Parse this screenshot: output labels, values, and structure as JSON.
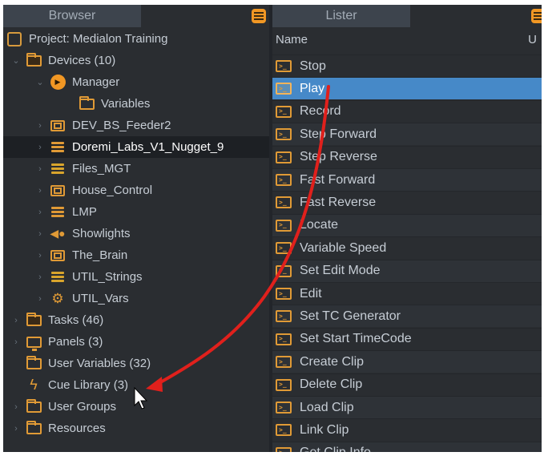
{
  "browser": {
    "title": "Browser",
    "tree": [
      {
        "label": "Project: Medialon Training",
        "icon": "project-icon",
        "chevron": ""
      },
      {
        "label": "Devices (10)",
        "icon": "folder-icon",
        "chevron": "down"
      },
      {
        "label": "Manager",
        "icon": "manager-play-icon",
        "chevron": "down"
      },
      {
        "label": "Variables",
        "icon": "variables-folder-icon",
        "chevron": ""
      },
      {
        "label": "DEV_BS_Feeder2",
        "icon": "device-icon",
        "chevron": "right"
      },
      {
        "label": "Doremi_Labs_V1_Nugget_9",
        "icon": "server-stack-icon",
        "chevron": "right"
      },
      {
        "label": "Files_MGT",
        "icon": "files-stack-icon",
        "chevron": "right"
      },
      {
        "label": "House_Control",
        "icon": "device-icon",
        "chevron": "right"
      },
      {
        "label": "LMP",
        "icon": "server-stack-icon",
        "chevron": "right"
      },
      {
        "label": "Showlights",
        "icon": "spotlight-icon",
        "chevron": "right"
      },
      {
        "label": "The_Brain",
        "icon": "device-icon",
        "chevron": "right"
      },
      {
        "label": "UTIL_Strings",
        "icon": "strings-stack-icon",
        "chevron": "right"
      },
      {
        "label": "UTIL_Vars",
        "icon": "gear-icon",
        "chevron": "right"
      },
      {
        "label": "Tasks (46)",
        "icon": "tasks-folder-icon",
        "chevron": "right"
      },
      {
        "label": "Panels (3)",
        "icon": "monitor-icon",
        "chevron": "right"
      },
      {
        "label": "User Variables (32)",
        "icon": "user-variables-icon",
        "chevron": ""
      },
      {
        "label": "Cue Library (3)",
        "icon": "lightning-icon",
        "chevron": ""
      },
      {
        "label": "User Groups",
        "icon": "folder-icon",
        "chevron": "right"
      },
      {
        "label": "Resources",
        "icon": "folder-icon",
        "chevron": "right"
      }
    ],
    "selected_item": "Doremi_Labs_V1_Nugget_9"
  },
  "lister": {
    "title": "Lister",
    "columns": [
      "Name",
      "U"
    ],
    "items": [
      "Stop",
      "Play",
      "Record",
      "Step Forward",
      "Step Reverse",
      "Fast Forward",
      "Fast Reverse",
      "Locate",
      "Variable Speed",
      "Set Edit Mode",
      "Edit",
      "Set TC Generator",
      "Set Start TimeCode",
      "Create Clip",
      "Delete Clip",
      "Load Clip",
      "Link Clip",
      "Get Clip Info"
    ],
    "selected_item": "Play"
  },
  "annotation": {
    "arrow_color": "#e0201c",
    "from": "Play",
    "to": "Cue Library (3)"
  },
  "colors": {
    "panel_bg": "#2a2d31",
    "header_tab": "#3d444d",
    "accent_orange": "#f19724",
    "selection_blue": "#4689c8",
    "tree_selection": "#1d2024"
  }
}
